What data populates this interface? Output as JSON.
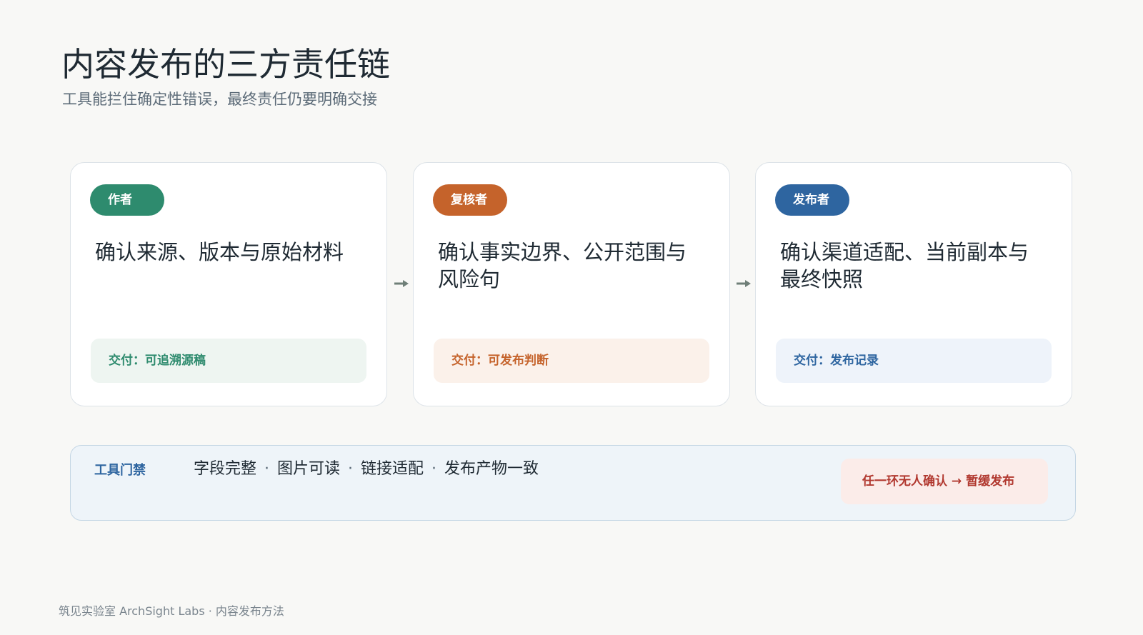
{
  "header": {
    "title": "内容发布的三方责任链",
    "subtitle": "工具能拦住确定性错误，最终责任仍要明确交接"
  },
  "colors": {
    "author": "#2e8b6e",
    "reviewer": "#c5632b",
    "publisher": "#2e65a0",
    "author_bg": "#eef5f1",
    "reviewer_bg": "#fbf1ea",
    "publisher_bg": "#eef3fa",
    "warning": "#b1382f"
  },
  "roles": [
    {
      "badge": "作者",
      "text": "确认来源、版本与原始材料",
      "deliverable": "交付：可追溯源稿"
    },
    {
      "badge": "复核者",
      "text": "确认事实边界、公开范围与风险句",
      "deliverable": "交付：可发布判断"
    },
    {
      "badge": "发布者",
      "text": "确认渠道适配、当前副本与最终快照",
      "deliverable": "交付：发布记录"
    }
  ],
  "gate": {
    "label": "工具门禁",
    "items": [
      "字段完整",
      "图片可读",
      "链接适配",
      "发布产物一致"
    ],
    "separator": "·",
    "warning": "任一环无人确认 → 暂缓发布"
  },
  "footer": {
    "text": "筑见实验室 ArchSight Labs · 内容发布方法"
  }
}
